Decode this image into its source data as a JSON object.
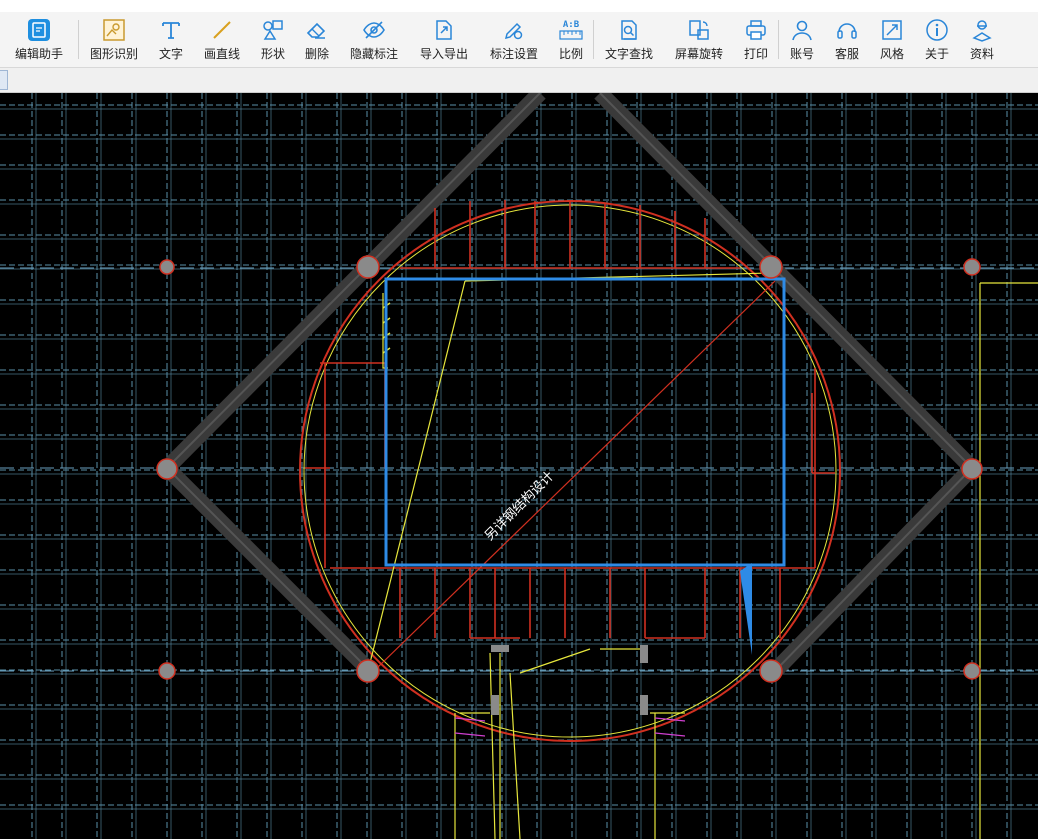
{
  "toolbar": {
    "items": [
      {
        "label": "编辑助手",
        "icon": "edit-assistant-icon"
      },
      {
        "label": "图形识别",
        "icon": "image-recognition-icon"
      },
      {
        "label": "文字",
        "icon": "text-icon"
      },
      {
        "label": "画直线",
        "icon": "line-icon"
      },
      {
        "label": "形状",
        "icon": "shape-icon"
      },
      {
        "label": "删除",
        "icon": "eraser-icon"
      },
      {
        "label": "隐藏标注",
        "icon": "eye-hide-icon"
      },
      {
        "label": "导入导出",
        "icon": "import-export-icon"
      },
      {
        "label": "标注设置",
        "icon": "annotation-settings-icon"
      },
      {
        "label": "比例",
        "icon": "scale-icon"
      },
      {
        "label": "文字查找",
        "icon": "text-search-icon"
      },
      {
        "label": "屏幕旋转",
        "icon": "rotate-screen-icon"
      },
      {
        "label": "打印",
        "icon": "printer-icon"
      },
      {
        "label": "账号",
        "icon": "user-icon"
      },
      {
        "label": "客服",
        "icon": "headset-icon"
      },
      {
        "label": "风格",
        "icon": "style-icon"
      },
      {
        "label": "关于",
        "icon": "info-icon"
      },
      {
        "label": "资料",
        "icon": "docs-icon"
      }
    ],
    "scale_glyph": "A:B"
  },
  "canvas": {
    "annotation_text": "另详钢结构设计",
    "colors": {
      "background": "#000000",
      "grid": "#5a8fa8",
      "dark_band": "#3a3a3a",
      "red": "#d03020",
      "yellow": "#e6e63c",
      "blue": "#2e8be6",
      "magenta": "#d040d0",
      "node": "#8a8a8a"
    }
  }
}
